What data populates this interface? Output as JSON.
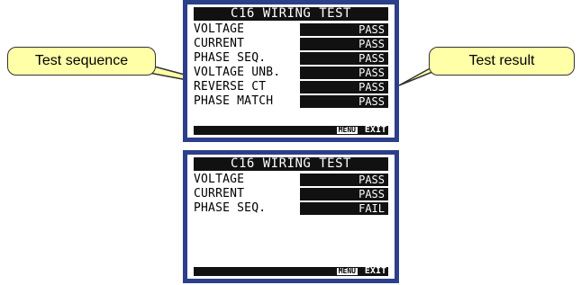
{
  "panels": [
    {
      "title": "C16 WIRING TEST",
      "rows": [
        {
          "label": "VOLTAGE",
          "result": "PASS"
        },
        {
          "label": "CURRENT",
          "result": "PASS"
        },
        {
          "label": "PHASE SEQ.",
          "result": "PASS"
        },
        {
          "label": "VOLTAGE UNB.",
          "result": "PASS"
        },
        {
          "label": "REVERSE CT",
          "result": "PASS"
        },
        {
          "label": "PHASE MATCH",
          "result": "PASS"
        }
      ],
      "footer": {
        "menu": "MENU",
        "exit": "EXIT"
      }
    },
    {
      "title": "C16 WIRING TEST",
      "rows": [
        {
          "label": "VOLTAGE",
          "result": "PASS"
        },
        {
          "label": "CURRENT",
          "result": "PASS"
        },
        {
          "label": "PHASE SEQ.",
          "result": "FAIL"
        }
      ],
      "footer": {
        "menu": "MENU",
        "exit": "EXIT"
      }
    }
  ],
  "callouts": {
    "sequence": "Test sequence",
    "result": "Test result"
  },
  "colors": {
    "bezel": "#2b3f8a",
    "callout_fill": "#ffffa8"
  }
}
